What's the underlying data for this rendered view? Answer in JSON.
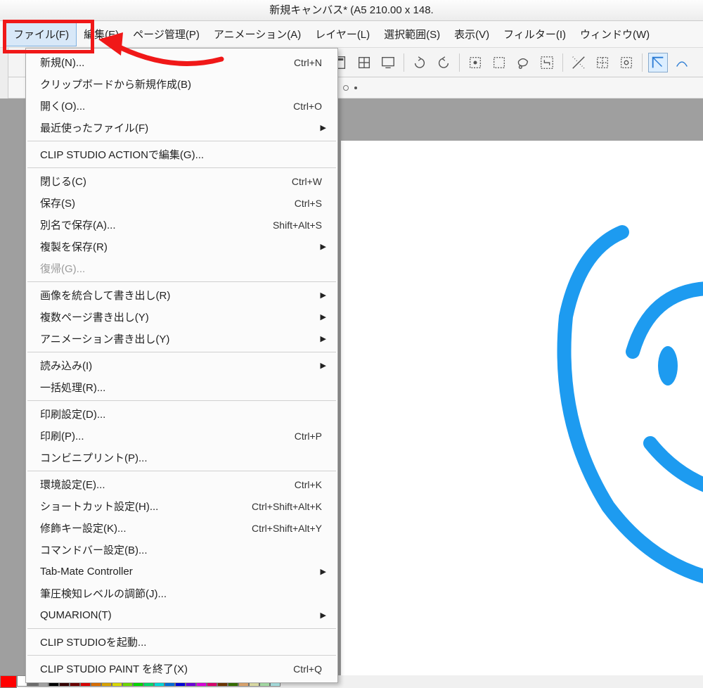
{
  "title": "新規キャンバス* (A5 210.00 x 148.",
  "menubar": [
    {
      "label": "ファイル(F)",
      "open": true
    },
    {
      "label": "編集(E)"
    },
    {
      "label": "ページ管理(P)"
    },
    {
      "label": "アニメーション(A)"
    },
    {
      "label": "レイヤー(L)"
    },
    {
      "label": "選択範囲(S)"
    },
    {
      "label": "表示(V)"
    },
    {
      "label": "フィルター(I)"
    },
    {
      "label": "ウィンドウ(W)"
    }
  ],
  "dropdown": [
    {
      "type": "item",
      "label": "新規(N)...",
      "shortcut": "Ctrl+N"
    },
    {
      "type": "item",
      "label": "クリップボードから新規作成(B)"
    },
    {
      "type": "item",
      "label": "開く(O)...",
      "shortcut": "Ctrl+O"
    },
    {
      "type": "item",
      "label": "最近使ったファイル(F)",
      "submenu": true
    },
    {
      "type": "sep"
    },
    {
      "type": "item",
      "label": "CLIP STUDIO ACTIONで編集(G)..."
    },
    {
      "type": "sep"
    },
    {
      "type": "item",
      "label": "閉じる(C)",
      "shortcut": "Ctrl+W"
    },
    {
      "type": "item",
      "label": "保存(S)",
      "shortcut": "Ctrl+S"
    },
    {
      "type": "item",
      "label": "別名で保存(A)...",
      "shortcut": "Shift+Alt+S"
    },
    {
      "type": "item",
      "label": "複製を保存(R)",
      "submenu": true
    },
    {
      "type": "item",
      "label": "復帰(G)...",
      "disabled": true
    },
    {
      "type": "sep"
    },
    {
      "type": "item",
      "label": "画像を統合して書き出し(R)",
      "submenu": true
    },
    {
      "type": "item",
      "label": "複数ページ書き出し(Y)",
      "submenu": true
    },
    {
      "type": "item",
      "label": "アニメーション書き出し(Y)",
      "submenu": true
    },
    {
      "type": "sep"
    },
    {
      "type": "item",
      "label": "読み込み(I)",
      "submenu": true
    },
    {
      "type": "item",
      "label": "一括処理(R)..."
    },
    {
      "type": "sep"
    },
    {
      "type": "item",
      "label": "印刷設定(D)..."
    },
    {
      "type": "item",
      "label": "印刷(P)...",
      "shortcut": "Ctrl+P"
    },
    {
      "type": "item",
      "label": "コンビニプリント(P)..."
    },
    {
      "type": "sep"
    },
    {
      "type": "item",
      "label": "環境設定(E)...",
      "shortcut": "Ctrl+K"
    },
    {
      "type": "item",
      "label": "ショートカット設定(H)...",
      "shortcut": "Ctrl+Shift+Alt+K"
    },
    {
      "type": "item",
      "label": "修飾キー設定(K)...",
      "shortcut": "Ctrl+Shift+Alt+Y"
    },
    {
      "type": "item",
      "label": "コマンドバー設定(B)..."
    },
    {
      "type": "item",
      "label": "Tab-Mate Controller",
      "submenu": true
    },
    {
      "type": "item",
      "label": "筆圧検知レベルの調節(J)..."
    },
    {
      "type": "item",
      "label": "QUMARION(T)",
      "submenu": true
    },
    {
      "type": "sep"
    },
    {
      "type": "item",
      "label": "CLIP STUDIOを起動..."
    },
    {
      "type": "sep"
    },
    {
      "type": "item",
      "label": "CLIP STUDIO PAINT を終了(X)",
      "shortcut": "Ctrl+Q"
    }
  ],
  "palette_colors": [
    "#ff0000",
    "#ffffff",
    "#808080",
    "#c0c0c0",
    "#000000",
    "#400000",
    "#800000",
    "#ff0000",
    "#ff8000",
    "#ffc000",
    "#ffff00",
    "#80ff00",
    "#00ff00",
    "#00ff80",
    "#00ffff",
    "#0080ff",
    "#0000ff",
    "#8000ff",
    "#ff00ff",
    "#ff0080",
    "#804000",
    "#408000",
    "#ffc080",
    "#ffffc0",
    "#c0ffc0",
    "#c0ffff"
  ]
}
